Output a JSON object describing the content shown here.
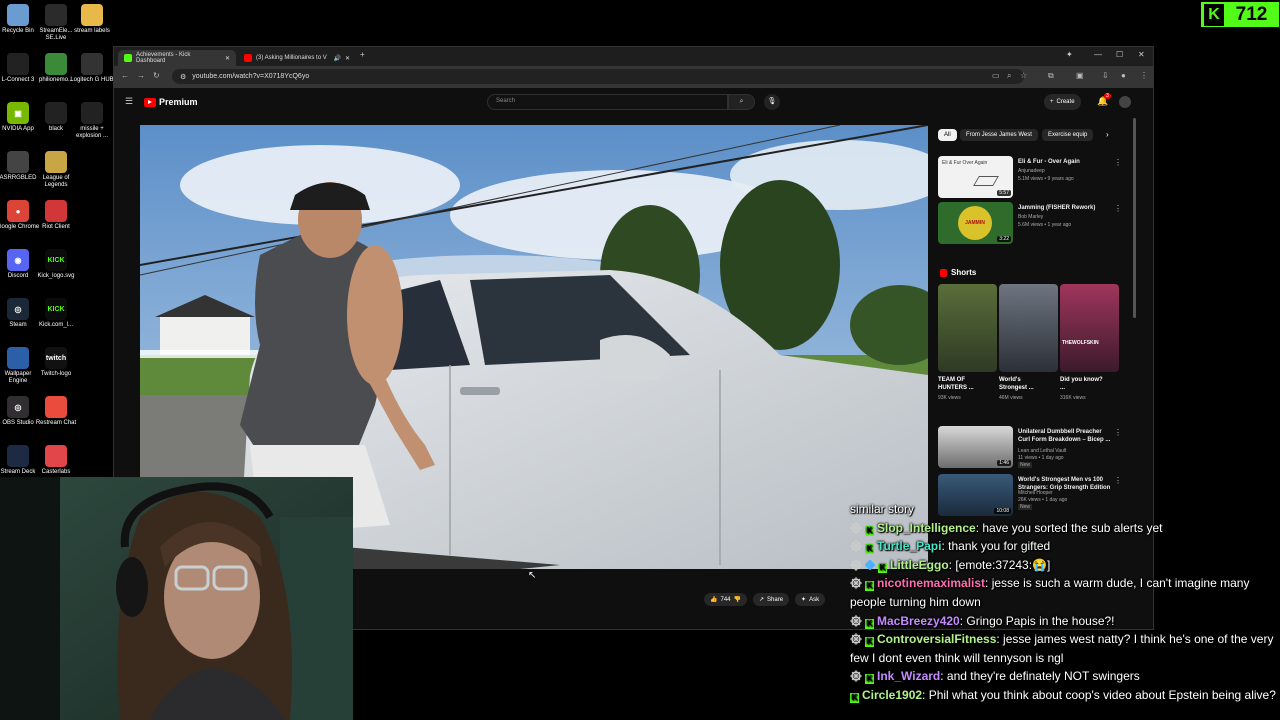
{
  "desktop": {
    "icons": [
      {
        "label": "Recycle Bin",
        "icon": "recycle-bin-icon"
      },
      {
        "label": "StreamEle... SE.Live",
        "icon": "streamelements-icon"
      },
      {
        "label": "stream labels",
        "icon": "folder-icon"
      },
      {
        "label": "L-Connect 3",
        "icon": "lconnect-icon"
      },
      {
        "label": "philionemo...",
        "icon": "app-icon"
      },
      {
        "label": "Logitech G HUB",
        "icon": "logitech-icon"
      },
      {
        "label": "NVIDIA App",
        "icon": "nvidia-icon"
      },
      {
        "label": "black",
        "icon": "image-icon"
      },
      {
        "label": "missile + explosion ...",
        "icon": "image-icon"
      },
      {
        "label": "ASRRGBLED",
        "icon": "asrock-icon"
      },
      {
        "label": "League of Legends",
        "icon": "league-icon"
      },
      {
        "label": "Google Chrome",
        "icon": "chrome-icon"
      },
      {
        "label": "Riot Client",
        "icon": "riot-icon"
      },
      {
        "label": "Discord",
        "icon": "discord-icon"
      },
      {
        "label": "Kick_logo.svg",
        "icon": "kick-icon"
      },
      {
        "label": "Steam",
        "icon": "steam-icon"
      },
      {
        "label": "Kick.com_l...",
        "icon": "kick-icon"
      },
      {
        "label": "Wallpaper Engine",
        "icon": "wallpaper-icon"
      },
      {
        "label": "Twitch-logo",
        "icon": "twitch-icon"
      },
      {
        "label": "OBS Studio",
        "icon": "obs-icon"
      },
      {
        "label": "Restream Chat",
        "icon": "restream-icon"
      },
      {
        "label": "Stream Deck",
        "icon": "streamdeck-icon"
      },
      {
        "label": "Casterlabs",
        "icon": "casterlabs-icon"
      }
    ]
  },
  "kick_counter": {
    "value": "712",
    "logo": "K"
  },
  "browser": {
    "tabs": [
      {
        "title": "Achievements - Kick Dashboard",
        "icon": "kick-icon"
      },
      {
        "title": "(3) Asking Millionaires to V",
        "icon": "youtube-icon"
      }
    ],
    "url": "youtube.com/watch?v=X0718YcQ6yo"
  },
  "youtube": {
    "logo_text": "Premium",
    "search_placeholder": "Search",
    "create_label": "Create",
    "notif_count": "3",
    "actions": {
      "likes": "744",
      "share": "Share",
      "ask": "Ask"
    },
    "chips": [
      "All",
      "From Jesse James West",
      "Exercise equip"
    ],
    "videos": [
      {
        "title": "Eli & Fur - Over Again",
        "channel": "Anjunadeep",
        "meta": "5.1M views • 9 years ago",
        "duration": "5:57",
        "thumb_text": "Eli & Fur Over Again"
      },
      {
        "title": "Jamming (FISHER Rework)",
        "channel": "Bob Marley",
        "meta": "5.6M views • 1 year ago",
        "duration": "3:22",
        "thumb_text": "JAMMIN"
      }
    ],
    "shorts_label": "Shorts",
    "shorts": [
      {
        "title": "TEAM OF HUNTERS ...",
        "views": "93K views"
      },
      {
        "title": "World's Strongest ...",
        "views": "46M views"
      },
      {
        "title": "Did you know? ...",
        "views": "316K views",
        "thumb_text": "THEWOLFSKIN"
      }
    ],
    "videos2": [
      {
        "title": "Unilateral Dumbbell Preacher Curl Form Breakdown – Bicep ...",
        "channel": "Lean and Lethal Vault",
        "meta": "11 views • 1 day ago",
        "badge": "New",
        "duration": "1:46"
      },
      {
        "title": "World's Strongest Men vs 100 Strangers: Grip Strength Edition",
        "channel": "Mitchell Hooper",
        "meta": "26K views • 1 day ago",
        "badge": "New",
        "duration": "10:08"
      }
    ]
  },
  "chat": {
    "messages": [
      {
        "user": "",
        "text": "similar story",
        "color": "#ffffff",
        "badges": []
      },
      {
        "user": "Slop_Intelligence",
        "text": ": have you sorted the sub alerts yet",
        "color": "#b3f28a",
        "badges": [
          "mod",
          "kick"
        ]
      },
      {
        "user": "Turtle_Papi",
        "text": ": thank you for gifted",
        "color": "#46e6c8",
        "badges": [
          "mod",
          "kick"
        ]
      },
      {
        "user": "LittleEggo",
        "text": ": [emote:37243:😭]",
        "color": "#b3f28a",
        "badges": [
          "mod",
          "gem",
          "kick"
        ]
      },
      {
        "user": "nicotinemaximalist",
        "text": ": jesse is such a warm dude, I can't imagine many people turning him down",
        "color": "#ff6fb0",
        "badges": [
          "mod",
          "kick"
        ]
      },
      {
        "user": "MacBreezy420",
        "text": ": Gringo Papis in the house?!",
        "color": "#c48cff",
        "badges": [
          "mod",
          "kick"
        ]
      },
      {
        "user": "ControversialFitness",
        "text": ": jesse james west natty? I think he's one of the very few I dont even think will tennyson is ngl",
        "color": "#b3f28a",
        "badges": [
          "mod",
          "kick"
        ]
      },
      {
        "user": "Ink_Wizard",
        "text": ": and they're definately NOT swingers",
        "color": "#c48cff",
        "badges": [
          "mod",
          "kick"
        ]
      },
      {
        "user": "Circle1902",
        "text": ": Phil what you think about coop's video about Epstein being alive?",
        "color": "#b3f28a",
        "badges": [
          "kick"
        ]
      }
    ]
  }
}
